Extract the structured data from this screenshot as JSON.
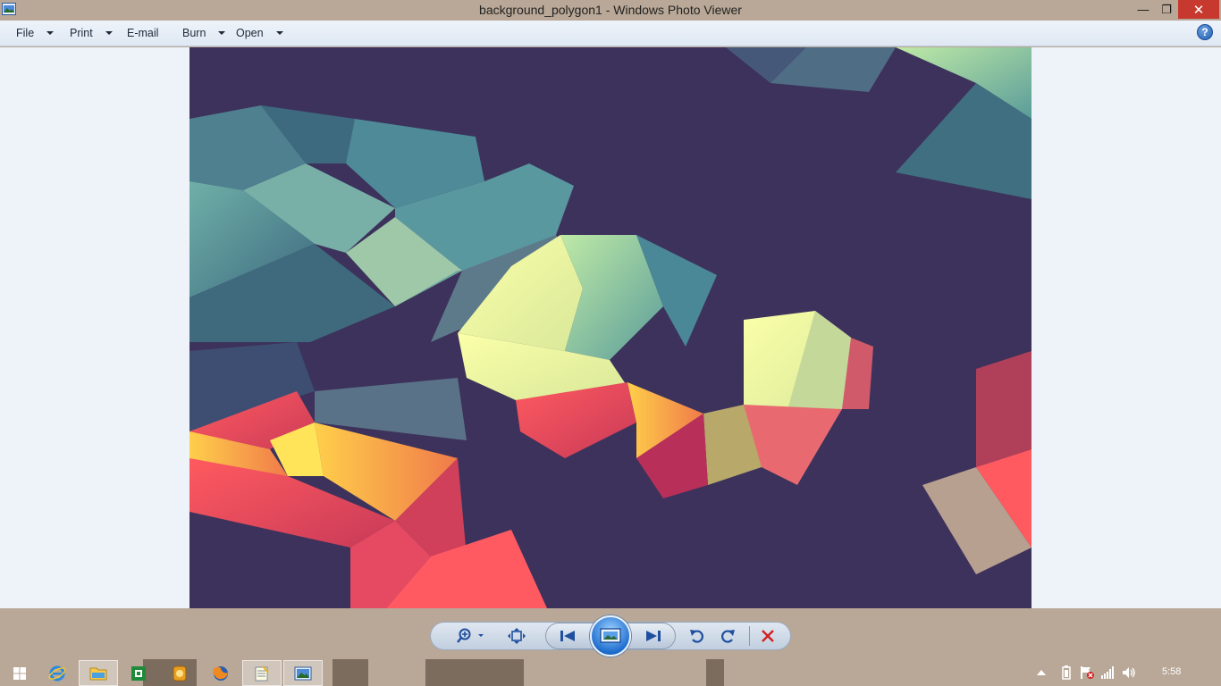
{
  "window": {
    "title": "background_polygon1 - Windows Photo Viewer",
    "min_glyph": "—",
    "max_glyph": "❐",
    "close_glyph": "✕"
  },
  "menu": {
    "file": "File",
    "print": "Print",
    "email": "E-mail",
    "burn": "Burn",
    "open": "Open",
    "help_glyph": "?"
  },
  "photo": {
    "icon": "polygon-wallpaper"
  },
  "controls": {
    "icons": [
      "zoom-icon",
      "fit-to-window-icon",
      "previous-icon",
      "slideshow-icon",
      "next-icon",
      "rotate-counterclockwise-icon",
      "rotate-clockwise-icon",
      "delete-icon"
    ]
  },
  "taskbar": {
    "time": "5:58",
    "apps": [
      "start",
      "internet-explorer",
      "file-explorer",
      "excel",
      "app",
      "firefox",
      "notepad",
      "photo-viewer"
    ]
  },
  "colors": {
    "chrome": "#b9a897",
    "close": "#c7392f",
    "accent": "#1f6fd0",
    "delete": "#d02020"
  }
}
